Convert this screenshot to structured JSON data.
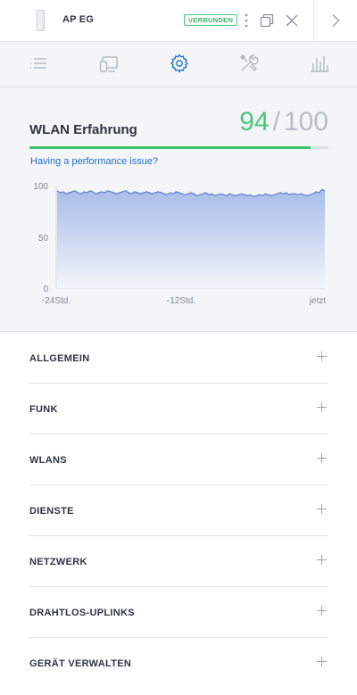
{
  "header": {
    "device_name": "AP EG",
    "status": "VERBUNDEN",
    "colors": {
      "status": "#38b56b",
      "accent": "#1d6ec9"
    }
  },
  "tabs": [
    {
      "icon": "details-list-icon",
      "active": false
    },
    {
      "icon": "devices-icon",
      "active": false
    },
    {
      "icon": "gear-icon",
      "active": true
    },
    {
      "icon": "tools-icon",
      "active": false
    },
    {
      "icon": "statistics-icon",
      "active": false
    }
  ],
  "experience": {
    "title": "WLAN Erfahrung",
    "score": "94",
    "score_separator": "/",
    "score_max": "100",
    "score_fraction": 0.94,
    "link": "Having a performance issue?"
  },
  "chart_data": {
    "type": "area",
    "y_ticks": [
      "100",
      "50",
      "0"
    ],
    "x_ticks": [
      "-24Std.",
      "-12Std.",
      "jetzt"
    ],
    "ylim": [
      0,
      100
    ],
    "series": [
      {
        "values": [
          95,
          93,
          94,
          92,
          93,
          94,
          95,
          93,
          92,
          94,
          93,
          95,
          94,
          92,
          93,
          94,
          93,
          95,
          94,
          93,
          92,
          93,
          94,
          95,
          93,
          92,
          94,
          93,
          92,
          93,
          94,
          93,
          92,
          93,
          94,
          93,
          92,
          91,
          93,
          92,
          94,
          93,
          92,
          91,
          92,
          93,
          92,
          90,
          91,
          92,
          93,
          91,
          92,
          90,
          91,
          92,
          91,
          90,
          92,
          91,
          90,
          91,
          92,
          91,
          90,
          91,
          89,
          90,
          91,
          90,
          92,
          91,
          90,
          91,
          92,
          93,
          92,
          93,
          91,
          92,
          92,
          91,
          92,
          91,
          90,
          91,
          92,
          94,
          93,
          96,
          95
        ]
      }
    ],
    "grid": false,
    "colors": {
      "line": "#5b7fd1",
      "fill_top": "#a9bde9",
      "fill_bottom": "#f2f4fa"
    }
  },
  "sections": [
    {
      "label": "ALLGEMEIN"
    },
    {
      "label": "FUNK"
    },
    {
      "label": "WLANS"
    },
    {
      "label": "DIENSTE"
    },
    {
      "label": "NETZWERK"
    },
    {
      "label": "DRAHTLOS-UPLINKS"
    },
    {
      "label": "GERÄT VERWALTEN"
    }
  ]
}
